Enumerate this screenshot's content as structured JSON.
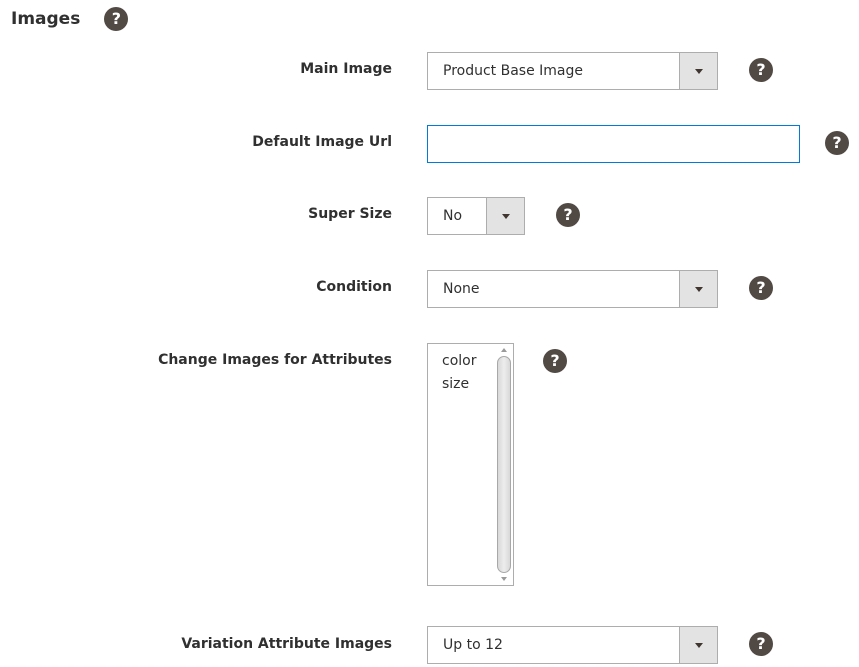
{
  "section": {
    "title": "Images",
    "help_glyph": "?"
  },
  "fields": {
    "main_image": {
      "label": "Main Image",
      "value": "Product Base Image"
    },
    "default_image_url": {
      "label": "Default Image Url",
      "value": ""
    },
    "super_size": {
      "label": "Super Size",
      "value": "No"
    },
    "condition": {
      "label": "Condition",
      "value": "None"
    },
    "change_images_for_attributes": {
      "label": "Change Images for Attributes",
      "options": [
        "color",
        "size"
      ]
    },
    "variation_attribute_images": {
      "label": "Variation Attribute Images",
      "value": "Up to 12"
    }
  },
  "icons": {
    "help": "question-circle-icon",
    "dropdown": "chevron-down-icon"
  },
  "colors": {
    "help_bg": "#514943",
    "input_focus_border": "#007bdb",
    "select_arrow_bg": "#e3e3e3",
    "text": "#303030"
  }
}
